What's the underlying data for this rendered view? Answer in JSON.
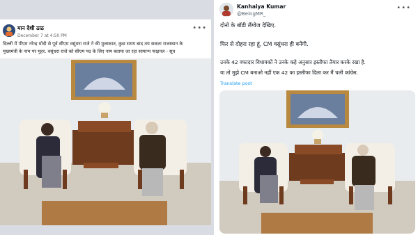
{
  "facebook_post": {
    "author": "मान देशी ठाठ",
    "timestamp": "December 7 at 4:50 PM",
    "text_line1": "दिल्ली में पीएम नरेन्द्र मोदी से पूर्व सीएम वसुंधरा राजे ने की मुलाकात, कुछ समय बाद तय सकता राजस्थान के",
    "text_line2": "मुख्यमंत्री के नाम पर मुहर. वसुंधरा राजे को सीएम पद के लिए नाम बताया जा रहा सामान्य फाइनल - सूत्र",
    "more_icon": "three-dots-icon",
    "image_alt": "photo-meeting"
  },
  "tweet": {
    "author": "Kanhaiya Kumar",
    "handle": "@BeingMR_",
    "line1": "दोनो के बॉडी लैंग्वेज देखिए.",
    "line2": "फिर से दोहरा रहा हूं, CM वसुंधरा ही बनेंगी.",
    "line3": "उनके 42 वफादार विधायकों ने उनके कहे अनुसार इस्तीफा तैयार करके रखा है.",
    "line4": "या तो मुझे CM बनाओ नहीं एक 42 का इस्तीफा दिला कर मैं चली कांग्रेस.",
    "translate_label": "Translate post",
    "more_icon": "three-dots-icon",
    "image_alt": "photo-meeting"
  },
  "colors": {
    "fb_text": "#1c1e21",
    "tw_link": "#1d9bf0",
    "background": "#d9dde3"
  }
}
